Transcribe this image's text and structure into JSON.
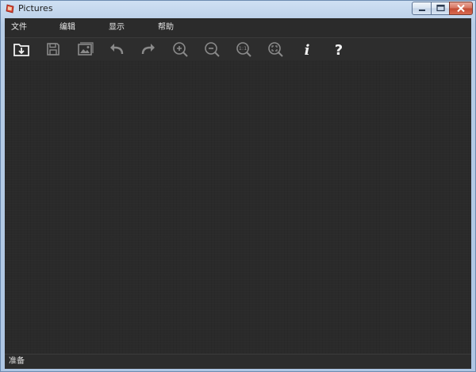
{
  "window": {
    "title": "Pictures",
    "colors": {
      "frame": "#b7cde6",
      "client": "#262626",
      "close": "#c24a33"
    }
  },
  "menu": {
    "items": [
      {
        "label": "文件"
      },
      {
        "label": "编辑"
      },
      {
        "label": "显示"
      },
      {
        "label": "帮助"
      }
    ]
  },
  "toolbar": {
    "tools": [
      {
        "icon": "open-folder-icon",
        "enabled": true
      },
      {
        "icon": "save-icon",
        "enabled": false
      },
      {
        "icon": "image-gallery-icon",
        "enabled": false
      },
      {
        "icon": "undo-icon",
        "enabled": false
      },
      {
        "icon": "redo-icon",
        "enabled": false
      },
      {
        "icon": "zoom-in-icon",
        "enabled": false
      },
      {
        "icon": "zoom-out-icon",
        "enabled": false
      },
      {
        "icon": "actual-size-icon",
        "enabled": false,
        "glyph": "1:1"
      },
      {
        "icon": "fit-to-window-icon",
        "enabled": false
      },
      {
        "icon": "info-icon",
        "enabled": true,
        "glyph": "i"
      },
      {
        "icon": "help-icon",
        "enabled": true,
        "glyph": "?"
      }
    ]
  },
  "status": {
    "text": "准备"
  }
}
